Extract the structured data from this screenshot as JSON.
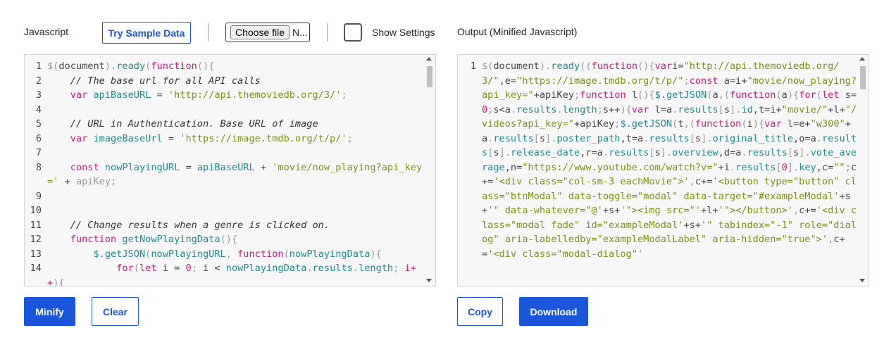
{
  "input_panel": {
    "title": "Javascript",
    "sample_button": "Try Sample Data",
    "file_button": "Choose file",
    "file_name": "N...",
    "settings_label": "Show Settings",
    "minify_button": "Minify",
    "clear_button": "Clear"
  },
  "output_panel": {
    "title": "Output (Minified Javascript)",
    "copy_button": "Copy",
    "download_button": "Download",
    "line_number": "1"
  },
  "colors": {
    "accent": "#1a56db",
    "keyword": "#c6197b",
    "string": "#7c8f10",
    "function": "#1d8a8c",
    "comment": "#333333",
    "editor_bg": "#f7f7f7"
  },
  "input_code": [
    {
      "n": "1",
      "tokens": [
        [
          "pn",
          "$("
        ],
        [
          "",
          "document"
        ],
        [
          "pn",
          ")."
        ],
        [
          "fn",
          "ready"
        ],
        [
          "pn",
          "("
        ],
        [
          "kw",
          "function"
        ],
        [
          "pn",
          "(){"
        ]
      ]
    },
    {
      "n": "2",
      "tokens": [
        [
          "",
          "    "
        ],
        [
          "cm",
          "// The base url for all API calls"
        ]
      ]
    },
    {
      "n": "3",
      "tokens": [
        [
          "",
          "    "
        ],
        [
          "kw",
          "var"
        ],
        [
          "",
          " "
        ],
        [
          "fn",
          "apiBaseURL"
        ],
        [
          "",
          " = "
        ],
        [
          "st",
          "'http://api.themoviedb.org/3/'"
        ],
        [
          "pn",
          ";"
        ]
      ]
    },
    {
      "n": "4",
      "tokens": []
    },
    {
      "n": "5",
      "tokens": [
        [
          "",
          "    "
        ],
        [
          "cm",
          "// URL in Authentication. Base URL of image"
        ]
      ]
    },
    {
      "n": "6",
      "tokens": [
        [
          "",
          "    "
        ],
        [
          "kw",
          "var"
        ],
        [
          "",
          " "
        ],
        [
          "fn",
          "imageBaseUrl"
        ],
        [
          "",
          " = "
        ],
        [
          "st",
          "'https://image.tmdb.org/t/p/'"
        ],
        [
          "pn",
          ";"
        ]
      ]
    },
    {
      "n": "7",
      "tokens": []
    },
    {
      "n": "8",
      "tokens": [
        [
          "",
          "    "
        ],
        [
          "kw",
          "const"
        ],
        [
          "",
          " "
        ],
        [
          "fn",
          "nowPlayingURL"
        ],
        [
          "",
          " = "
        ],
        [
          "fn",
          "apiBaseURL"
        ],
        [
          "",
          " + "
        ],
        [
          "st",
          "'movie/now_playing?api_key='"
        ],
        [
          "",
          " + "
        ],
        [
          "pn",
          "apiKey;"
        ]
      ]
    },
    {
      "n": "9",
      "tokens": []
    },
    {
      "n": "10",
      "tokens": []
    },
    {
      "n": "11",
      "tokens": [
        [
          "",
          "    "
        ],
        [
          "cm",
          "// Change results when a genre is clicked on."
        ]
      ]
    },
    {
      "n": "12",
      "tokens": [
        [
          "",
          "    "
        ],
        [
          "kw",
          "function"
        ],
        [
          "",
          " "
        ],
        [
          "fn",
          "getNowPlayingData"
        ],
        [
          "pn",
          "(){"
        ]
      ]
    },
    {
      "n": "13",
      "tokens": [
        [
          "",
          "        "
        ],
        [
          "fn",
          "$.getJSON"
        ],
        [
          "pn",
          "("
        ],
        [
          "fn",
          "nowPlayingURL"
        ],
        [
          "pn",
          ", "
        ],
        [
          "kw",
          "function"
        ],
        [
          "pn",
          "("
        ],
        [
          "fn",
          "nowPlayingData"
        ],
        [
          "pn",
          "){"
        ]
      ]
    },
    {
      "n": "14",
      "tokens": [
        [
          "",
          "            "
        ],
        [
          "kw",
          "for"
        ],
        [
          "pn",
          "("
        ],
        [
          "kw",
          "let"
        ],
        [
          "",
          " i = "
        ],
        [
          "nm",
          "0"
        ],
        [
          "pn",
          "; "
        ],
        [
          "",
          "i < "
        ],
        [
          "fn",
          "nowPlayingData"
        ],
        [
          "pn",
          "."
        ],
        [
          "fn",
          "results"
        ],
        [
          "pn",
          "."
        ],
        [
          "fn",
          "length"
        ],
        [
          "pn",
          ";"
        ],
        [
          "",
          " "
        ],
        [
          "kw",
          "i++"
        ],
        [
          "pn",
          "){"
        ]
      ]
    }
  ],
  "output_code": [
    [
      "pn",
      "$("
    ],
    [
      "",
      "document"
    ],
    [
      "pn",
      ")."
    ],
    [
      "fn",
      "ready"
    ],
    [
      "pn",
      "(("
    ],
    [
      "kw",
      "function"
    ],
    [
      "pn",
      "(){"
    ],
    [
      "kw",
      "var"
    ],
    [
      "",
      ""
    ],
    [
      "",
      "i="
    ],
    [
      "st",
      "\"http://api.themoviedb.org/3/\""
    ],
    [
      "",
      ",e="
    ],
    [
      "st",
      "\"https://image.tmdb.org/t/p/\""
    ],
    [
      "pn",
      ";"
    ],
    [
      "kw",
      "const"
    ],
    [
      "",
      " a=i+"
    ],
    [
      "st",
      "\"movie/now_playing?api_key=\""
    ],
    [
      "",
      "+apiKey"
    ],
    [
      "pn",
      ";"
    ],
    [
      "kw",
      "function"
    ],
    [
      "",
      " l"
    ],
    [
      "pn",
      "(){"
    ],
    [
      "fn",
      "$.getJSON"
    ],
    [
      "pn",
      "("
    ],
    [
      "",
      "a"
    ],
    [
      "pn",
      ",("
    ],
    [
      "kw",
      "function"
    ],
    [
      "pn",
      "("
    ],
    [
      "",
      "a"
    ],
    [
      "pn",
      "){"
    ],
    [
      "kw",
      "for"
    ],
    [
      "pn",
      "("
    ],
    [
      "kw",
      "let"
    ],
    [
      "",
      " s="
    ],
    [
      "nm",
      "0"
    ],
    [
      "pn",
      ";"
    ],
    [
      "",
      "s<a"
    ],
    [
      "pn",
      "."
    ],
    [
      "fn",
      "results"
    ],
    [
      "pn",
      "."
    ],
    [
      "fn",
      "length"
    ],
    [
      "pn",
      ";"
    ],
    [
      "",
      "s++"
    ],
    [
      "pn",
      ")"
    ],
    [
      "pn",
      "{"
    ],
    [
      "kw",
      "var"
    ],
    [
      "",
      " l=a"
    ],
    [
      "pn",
      "."
    ],
    [
      "fn",
      "results"
    ],
    [
      "pn",
      "["
    ],
    [
      "",
      "s"
    ],
    [
      "pn",
      "]."
    ],
    [
      "fn",
      "id"
    ],
    [
      "",
      ",t=i+"
    ],
    [
      "st",
      "\"movie/\""
    ],
    [
      "",
      "+l+"
    ],
    [
      "st",
      "\"/videos?api_key=\""
    ],
    [
      "",
      "+apiKey"
    ],
    [
      "pn",
      ";"
    ],
    [
      "fn",
      "$.getJSON"
    ],
    [
      "pn",
      "("
    ],
    [
      "",
      "t"
    ],
    [
      "pn",
      ",("
    ],
    [
      "kw",
      "function"
    ],
    [
      "pn",
      "("
    ],
    [
      "",
      "i"
    ],
    [
      "pn",
      "){"
    ],
    [
      "kw",
      "var"
    ],
    [
      "",
      " l=e+"
    ],
    [
      "st",
      "\"w300\""
    ],
    [
      "",
      "+a"
    ],
    [
      "pn",
      "."
    ],
    [
      "fn",
      "results"
    ],
    [
      "pn",
      "["
    ],
    [
      "",
      "s"
    ],
    [
      "pn",
      "]."
    ],
    [
      "fn",
      "poster_path"
    ],
    [
      "",
      ",t=a"
    ],
    [
      "pn",
      "."
    ],
    [
      "fn",
      "results"
    ],
    [
      "pn",
      "["
    ],
    [
      "",
      "s"
    ],
    [
      "pn",
      "]."
    ],
    [
      "fn",
      "original_title"
    ],
    [
      "",
      ",o=a"
    ],
    [
      "pn",
      "."
    ],
    [
      "fn",
      "results"
    ],
    [
      "pn",
      "["
    ],
    [
      "",
      "s"
    ],
    [
      "pn",
      "]."
    ],
    [
      "fn",
      "release_date"
    ],
    [
      "",
      ",r=a"
    ],
    [
      "pn",
      "."
    ],
    [
      "fn",
      "results"
    ],
    [
      "pn",
      "["
    ],
    [
      "",
      "s"
    ],
    [
      "pn",
      "]."
    ],
    [
      "fn",
      "overview"
    ],
    [
      "",
      ",d=a"
    ],
    [
      "pn",
      "."
    ],
    [
      "fn",
      "results"
    ],
    [
      "pn",
      "["
    ],
    [
      "",
      "s"
    ],
    [
      "pn",
      "]."
    ],
    [
      "fn",
      "vote_average"
    ],
    [
      "",
      ",n="
    ],
    [
      "st",
      "\"https://www.youtube.com/watch?v=\""
    ],
    [
      "",
      "+i"
    ],
    [
      "pn",
      "."
    ],
    [
      "fn",
      "results"
    ],
    [
      "pn",
      "["
    ],
    [
      "nm",
      "0"
    ],
    [
      "pn",
      "]."
    ],
    [
      "fn",
      "key"
    ],
    [
      "",
      ",c="
    ],
    [
      "st",
      "\"\""
    ],
    [
      "pn",
      ";"
    ],
    [
      "",
      "c+="
    ],
    [
      "st",
      "'<div class=\"col-sm-3 eachMovie\">'"
    ],
    [
      "pn",
      ","
    ],
    [
      "",
      "c+="
    ],
    [
      "st",
      "'<button type=\"button\" class=\"btnModal\" data-toggle=\"modal\" data-target=\"#exampleModal'"
    ],
    [
      "",
      "+s+"
    ],
    [
      "st",
      "'\" data-whatever=\"@'"
    ],
    [
      "",
      "+s+"
    ],
    [
      "st",
      "'\"><img src=\"'"
    ],
    [
      "",
      "+l+"
    ],
    [
      "st",
      "'\"></button>'"
    ],
    [
      "pn",
      ","
    ],
    [
      "",
      "c+="
    ],
    [
      "st",
      "'<div class=\"modal fade\" id=\"exampleModal'"
    ],
    [
      "",
      "+s+"
    ],
    [
      "st",
      "'\" tabindex=\"-1\" role=\"dialog\" aria-labelledby=\"exampleModalLabel\" aria-hidden=\"true\">'"
    ],
    [
      "pn",
      ","
    ],
    [
      "",
      "c+="
    ],
    [
      "st",
      "'<div class=\"modal-dialog\"'"
    ]
  ]
}
